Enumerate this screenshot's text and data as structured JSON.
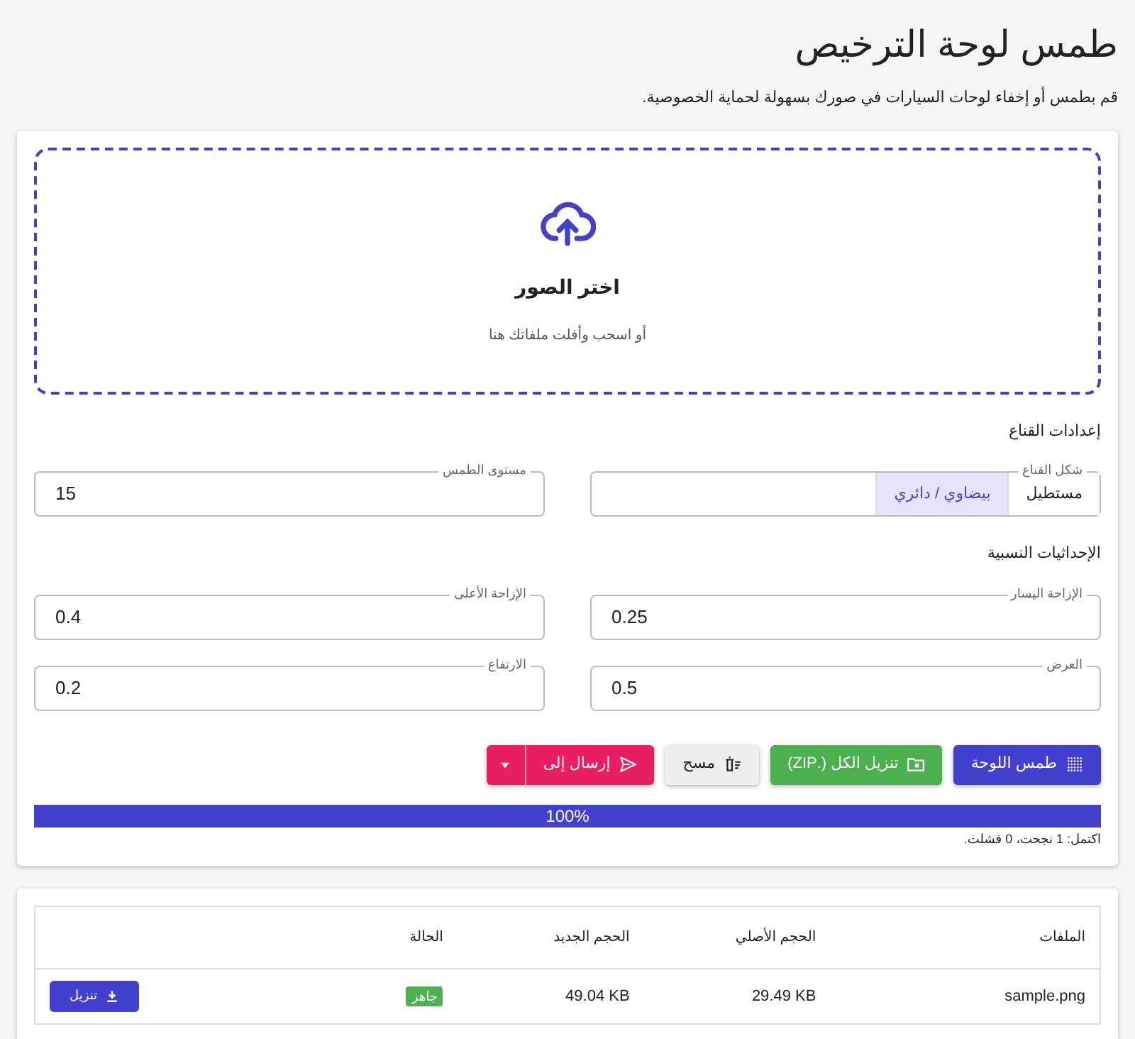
{
  "title": "طمس لوحة الترخيص",
  "subtitle": "قم بطمس أو إخفاء لوحات السيارات في صورك بسهولة لحماية الخصوصية.",
  "dropzone": {
    "label": "اختر الصور",
    "hint": "أو اسحب وأفلت ملفاتك هنا"
  },
  "mask_settings": {
    "heading": "إعدادات القناع",
    "shape": {
      "label": "شكل القناع",
      "options": [
        {
          "label": "مستطيل",
          "selected": false
        },
        {
          "label": "بيضاوي / دائري",
          "selected": true
        }
      ]
    },
    "blur_level": {
      "label": "مستوى الطمس",
      "value": "15"
    }
  },
  "coordinates": {
    "heading": "الإحداثيات النسبية",
    "fields": [
      {
        "label": "الإزاحة اليسار",
        "value": "0.25"
      },
      {
        "label": "الإزاحة الأعلى",
        "value": "0.4"
      },
      {
        "label": "العرض",
        "value": "0.5"
      },
      {
        "label": "الارتفاع",
        "value": "0.2"
      }
    ]
  },
  "actions": [
    {
      "label": "طمس اللوحة",
      "kind": "blur"
    },
    {
      "label": "تنزيل الكل (.ZIP)",
      "kind": "zip"
    },
    {
      "label": "مسح",
      "kind": "clear"
    },
    {
      "label": "إرسال إلى",
      "kind": "send"
    }
  ],
  "progress": {
    "level": 1,
    "text": "100%"
  },
  "summary": "اكتمل: 1 نجحت، 0 فشلت.",
  "table": {
    "columns": [
      "الملفات",
      "الحجم الأصلي",
      "الحجم الجديد",
      "الحالة"
    ],
    "rows": [
      {
        "cells": [
          "sample.png",
          "29.49 KB",
          "49.04 KB"
        ],
        "status": "جاهز",
        "action": "تنزيل"
      }
    ]
  }
}
